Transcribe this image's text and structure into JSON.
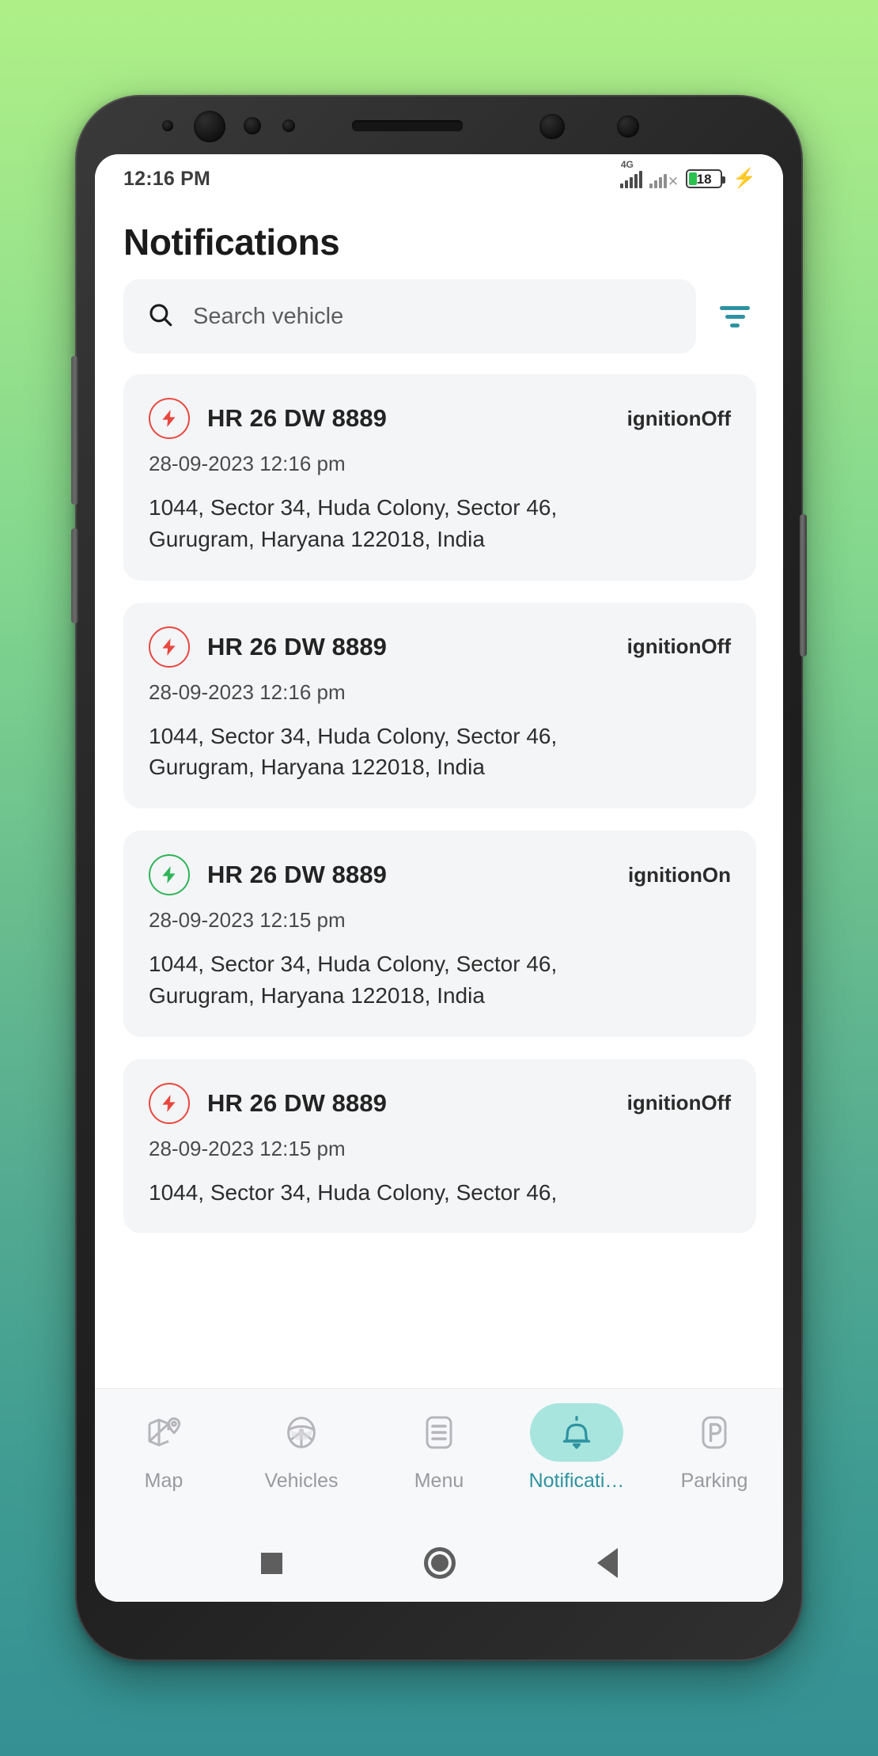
{
  "status_bar": {
    "time": "12:16 PM",
    "network_label": "4G",
    "no_signal_glyph": "✕",
    "battery_level": "18",
    "charging_glyph": "⚡",
    "battery_color": "#29C24E"
  },
  "header": {
    "title": "Notifications"
  },
  "search": {
    "placeholder": "Search vehicle",
    "icon": "search-icon",
    "filter_icon": "filter-icon",
    "filter_color": "#2E93A0"
  },
  "notifications": [
    {
      "plate": "HR 26 DW 8889",
      "state": "ignitionOff",
      "state_type": "off",
      "timestamp": "28-09-2023 12:16 pm",
      "address": "1044, Sector 34, Huda Colony, Sector 46, Gurugram, Haryana 122018, India"
    },
    {
      "plate": "HR 26 DW 8889",
      "state": "ignitionOff",
      "state_type": "off",
      "timestamp": "28-09-2023 12:16 pm",
      "address": "1044, Sector 34, Huda Colony, Sector 46, Gurugram, Haryana 122018, India"
    },
    {
      "plate": "HR 26 DW 8889",
      "state": "ignitionOn",
      "state_type": "on",
      "timestamp": "28-09-2023 12:15 pm",
      "address": "1044, Sector 34, Huda Colony, Sector 46, Gurugram, Haryana 122018, India"
    },
    {
      "plate": "HR 26 DW 8889",
      "state": "ignitionOff",
      "state_type": "off",
      "timestamp": "28-09-2023 12:15 pm",
      "address": "1044, Sector 34, Huda Colony, Sector 46,"
    }
  ],
  "colors": {
    "ignition_off": "#E8483F",
    "ignition_on": "#2FB457",
    "accent": "#2E93A0",
    "active_pill": "#A9E5DF",
    "card_bg": "#F4F5F7"
  },
  "bottom_nav": [
    {
      "label": "Map",
      "icon": "map-route-icon",
      "active": false
    },
    {
      "label": "Vehicles",
      "icon": "steering-wheel-icon",
      "active": false
    },
    {
      "label": "Menu",
      "icon": "list-menu-icon",
      "active": false
    },
    {
      "label": "Notificati…",
      "icon": "bell-icon",
      "active": true
    },
    {
      "label": "Parking",
      "icon": "parking-p-icon",
      "active": false
    }
  ],
  "system_nav": [
    {
      "label": "recents",
      "icon": "square-icon"
    },
    {
      "label": "home",
      "icon": "circle-icon"
    },
    {
      "label": "back",
      "icon": "triangle-back-icon"
    }
  ]
}
